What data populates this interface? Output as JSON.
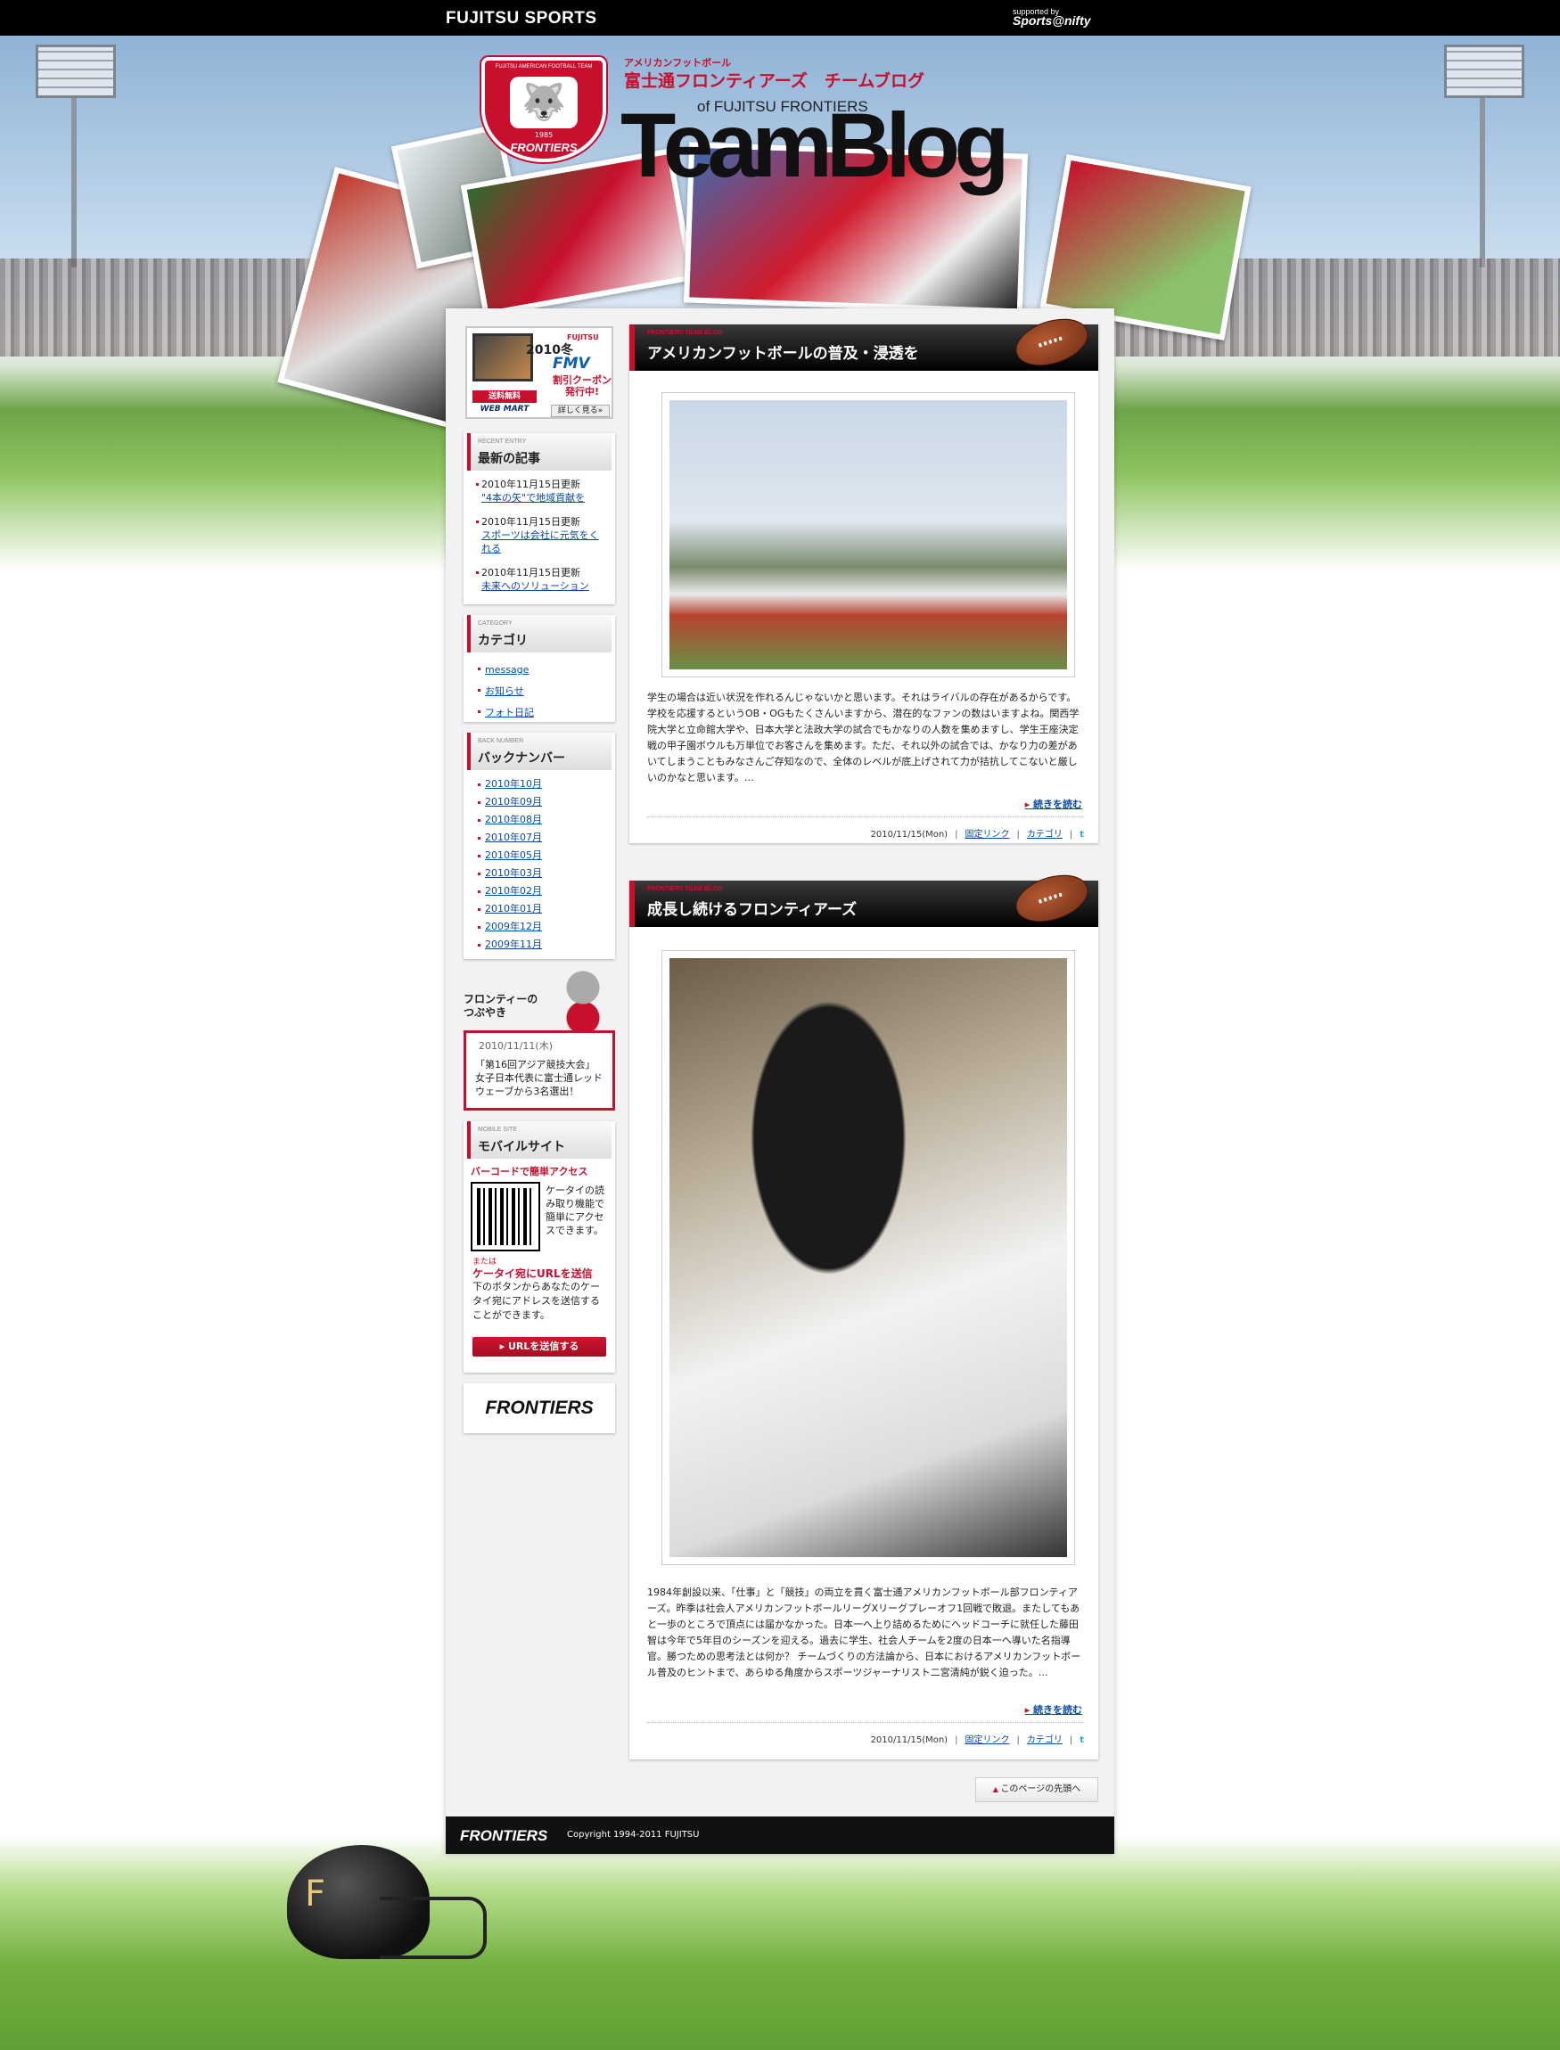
{
  "topbar": {
    "brand": "FUJITSU SPORTS",
    "supported_by": "supported by",
    "supporter": "Sports@nifty"
  },
  "header": {
    "logo_team": "FUJITSU AMERICAN FOOTBALL TEAM",
    "logo_year": "1985",
    "logo_name": "FRONTIERS",
    "sub_small": "アメリカンフットボール",
    "sub_main": "富士通フロンティアーズ　チームブログ",
    "of_line": "of FUJITSU FRONTIERS",
    "big_title": "TeamBlog"
  },
  "ad": {
    "year": "2010冬",
    "maker": "FUJITSU",
    "product": "FMV",
    "coupon": "割引クーポン発行中!",
    "free": "送料無料",
    "shop": "WEB MART",
    "more": "詳しく見る»"
  },
  "recent": {
    "label_small": "RECENT ENTRY",
    "label": "最新の記事",
    "items": [
      {
        "date": "2010年11月15日更新",
        "title": "\"4本の矢\"で地域貢献を"
      },
      {
        "date": "2010年11月15日更新",
        "title": "スポーツは会社に元気をくれる"
      },
      {
        "date": "2010年11月15日更新",
        "title": "未来へのソリューション"
      }
    ]
  },
  "category": {
    "label_small": "CATEGORY",
    "label": "カテゴリ",
    "items": [
      "message",
      "お知らせ",
      "フォト日記"
    ]
  },
  "backnumber": {
    "label_small": "BACK NUMBER",
    "label": "バックナンバー",
    "items": [
      "2010年10月",
      "2010年09月",
      "2010年08月",
      "2010年07月",
      "2010年05月",
      "2010年03月",
      "2010年02月",
      "2010年01月",
      "2009年12月",
      "2009年11月"
    ]
  },
  "tweet": {
    "label": "フロンティーの\nつぶやき",
    "date": "2010/11/11(木)",
    "text": "「第16回アジア競技大会」女子日本代表に富士通レッドウェーブから3名選出！"
  },
  "mobile": {
    "label_small": "MOBILE SITE",
    "label": "モバイルサイト",
    "barcode_heading": "バーコードで簡単アクセス",
    "barcode_text": "ケータイの読み取り機能で簡単にアクセスできます。",
    "or": "または",
    "send_heading": "ケータイ宛にURLを送信",
    "send_text": "下のボタンからあなたのケータイ宛にアドレスを送信することができます。",
    "button": "URLを送信する"
  },
  "frontiers_banner": "FRONTIERS",
  "posts": [
    {
      "tag": "FRONTIERS TEAM BLOG",
      "title": "アメリカンフットボールの普及・浸透を",
      "body": "学生の場合は近い状況を作れるんじゃないかと思います。それはライバルの存在があるからです。学校を応援するというOB・OGもたくさんいますから、潜在的なファンの数はいますよね。関西学院大学と立命館大学や、日本大学と法政大学の試合でもかなりの人数を集めますし、学生王座決定戦の甲子園ボウルも万単位でお客さんを集めます。ただ、それ以外の試合では、かなり力の差があいてしまうこともみなさんご存知なので、全体のレベルが底上げされて力が拮抗してこないと厳しいのかなと思います。…",
      "more": "続きを読む",
      "date": "2010/11/15(Mon)",
      "permalink": "固定リンク",
      "category": "カテゴリ",
      "twitter": "t"
    },
    {
      "tag": "FRONTIERS TEAM BLOG",
      "title": "成長し続けるフロンティアーズ",
      "body": "1984年創設以来、「仕事」と「競技」の両立を貫く富士通アメリカンフットボール部フロンティアーズ。昨季は社会人アメリカンフットボールリーグXリーグプレーオフ1回戦で敗退。またしてもあと一歩のところで頂点には届かなかった。日本一へ上り詰めるためにヘッドコーチに就任した藤田智は今年で5年目のシーズンを迎える。過去に学生、社会人チームを2度の日本一へ導いた名指導官。勝つための思考法とは何か？ チームづくりの方法論から、日本におけるアメリカンフットボール普及のヒントまで、あらゆる角度からスポーツジャーナリスト二宮清純が鋭く迫った。…",
      "more": "続きを読む",
      "date": "2010/11/15(Mon)",
      "permalink": "固定リンク",
      "category": "カテゴリ",
      "twitter": "t"
    }
  ],
  "pagetop": "このページの先頭へ",
  "footer": {
    "logo": "FRONTIERS",
    "copyright": "Copyright 1994-2011 FUJITSU"
  }
}
